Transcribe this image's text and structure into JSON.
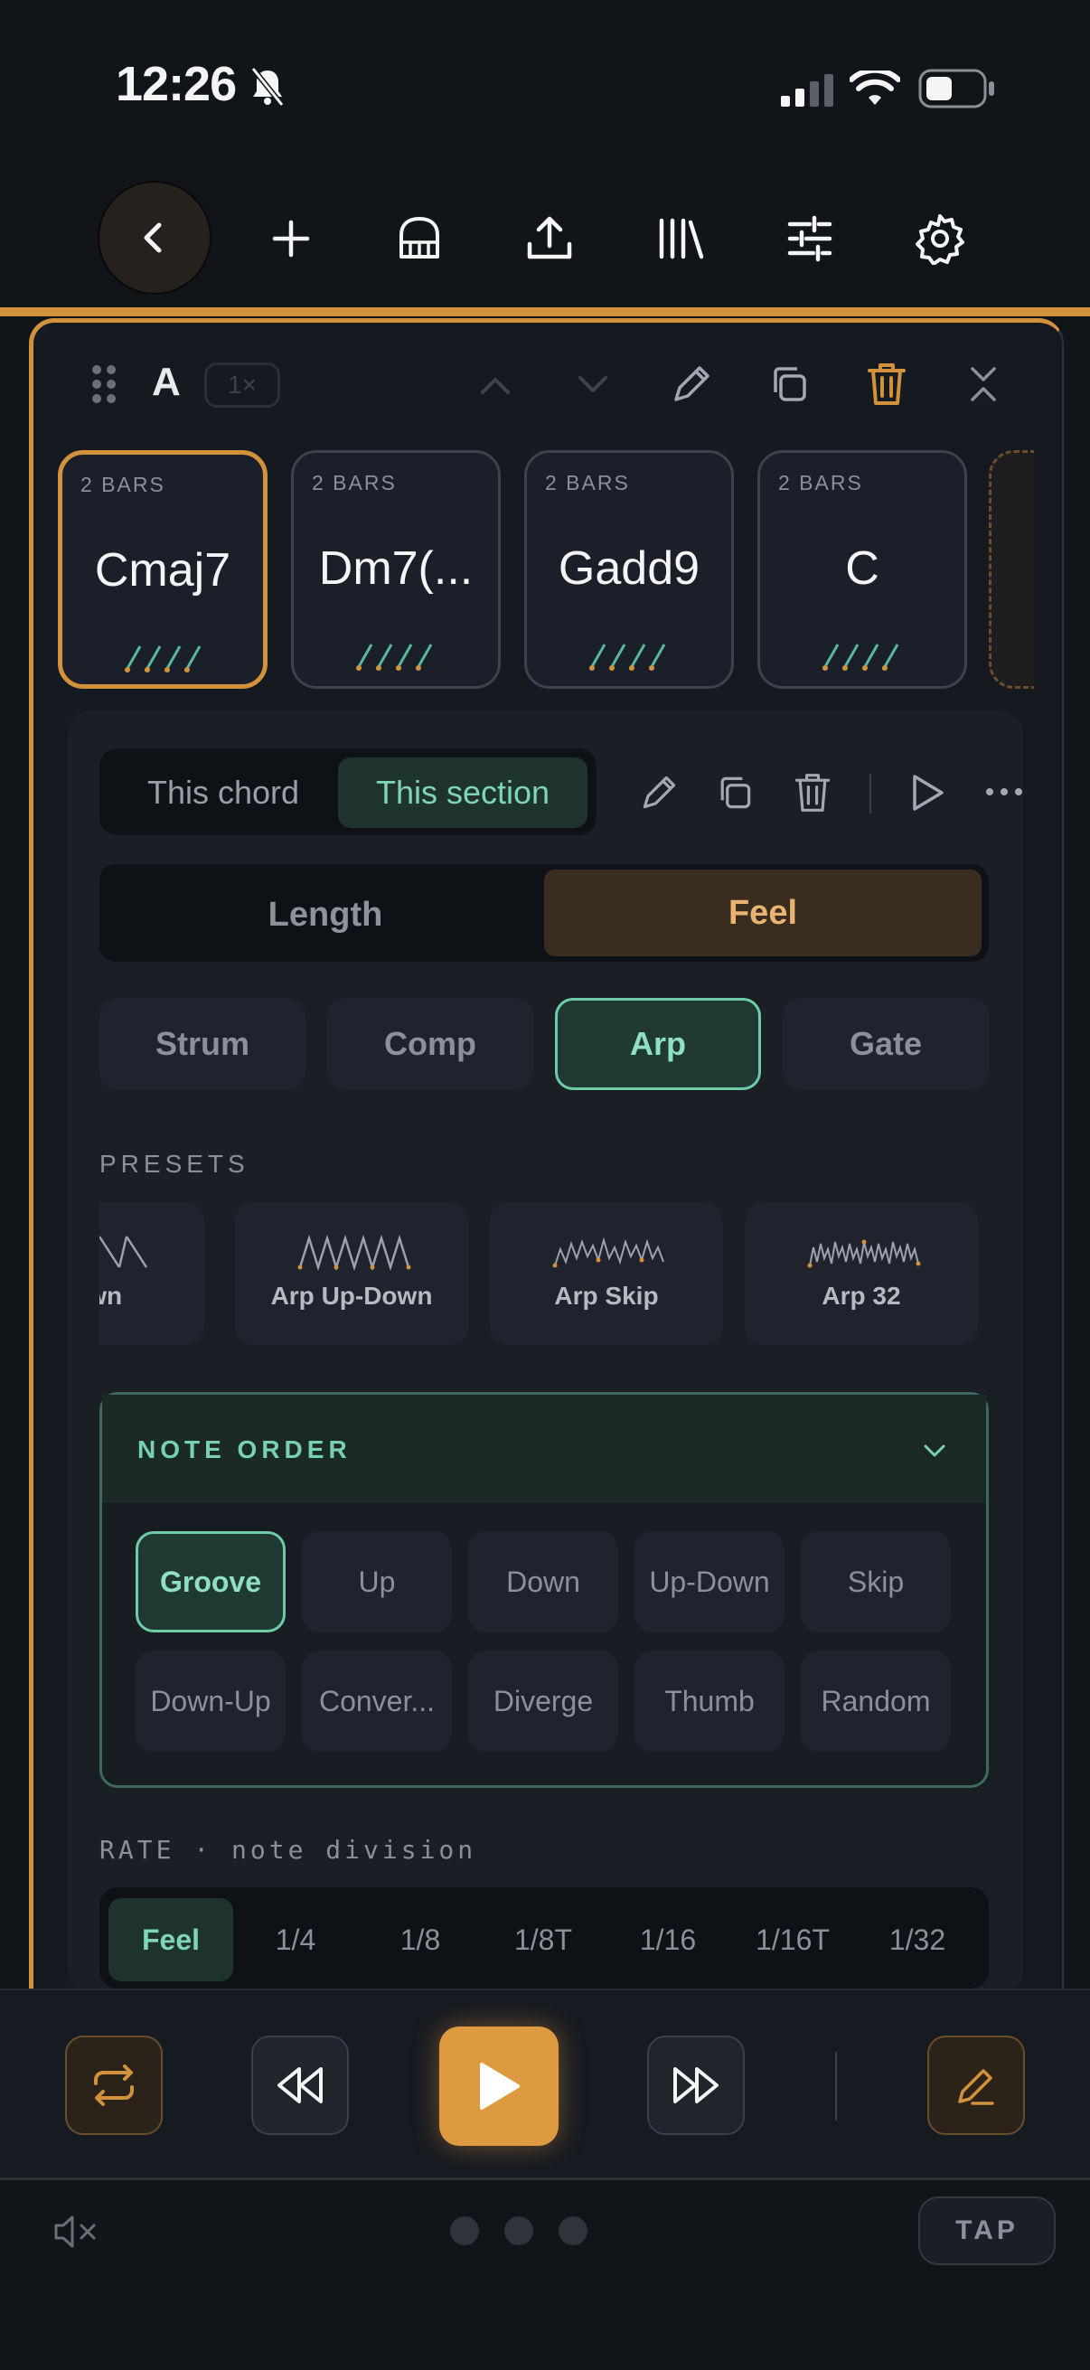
{
  "status_bar": {
    "time": "12:26"
  },
  "section": {
    "name": "A",
    "repeat": "1×"
  },
  "chords": [
    {
      "bars": "2 BARS",
      "name": "Cmaj7",
      "selected": true
    },
    {
      "bars": "2 BARS",
      "name": "Dm7(..."
    },
    {
      "bars": "2 BARS",
      "name": "Gadd9"
    },
    {
      "bars": "2 BARS",
      "name": "C"
    }
  ],
  "scope": {
    "chord_label": "This chord",
    "section_label": "This section"
  },
  "length_feel": {
    "length": "Length",
    "feel": "Feel"
  },
  "modes": [
    "Strum",
    "Comp",
    "Arp",
    "Gate"
  ],
  "active_mode": "Arp",
  "presets": {
    "label": "PRESETS",
    "items": [
      "Down",
      "Arp Up-Down",
      "Arp Skip",
      "Arp 32"
    ]
  },
  "note_order": {
    "title": "NOTE ORDER",
    "options": [
      "Groove",
      "Up",
      "Down",
      "Up-Down",
      "Skip",
      "Down-Up",
      "Conver...",
      "Diverge",
      "Thumb",
      "Random"
    ],
    "selected": "Groove"
  },
  "rate": {
    "label": "RATE · note division",
    "options": [
      "Feel",
      "1/4",
      "1/8",
      "1/8T",
      "1/16",
      "1/16T",
      "1/32"
    ],
    "selected": "Feel"
  },
  "tap_label": "TAP",
  "colors": {
    "accent": "#d2913b",
    "teal": "#7fd6b4",
    "bg": "#111419"
  }
}
